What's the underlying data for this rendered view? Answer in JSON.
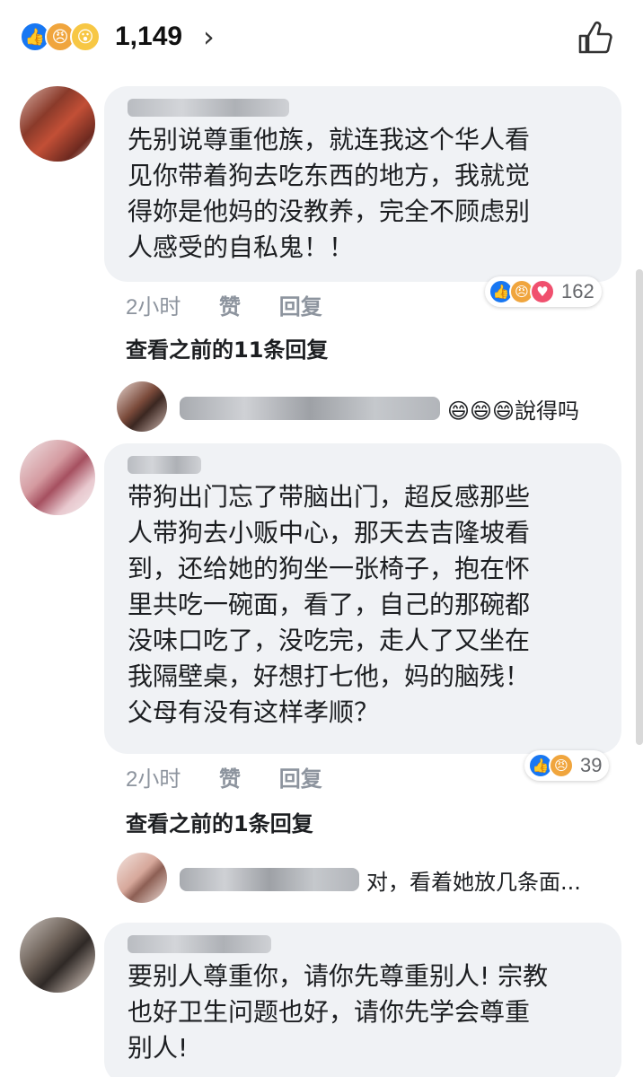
{
  "header": {
    "reaction_icons": [
      "like-icon",
      "angry-icon",
      "wow-icon"
    ],
    "reaction_count": "1,149",
    "chevron": "›"
  },
  "comments": [
    {
      "text": "先别说尊重他族，就连我这个华人看\n见你带着狗去吃东西的地方，我就觉\n得妳是他妈的没教养，完全不顾虑别\n人感受的自私鬼！！",
      "time": "2小时",
      "like_label": "赞",
      "reply_label": "回复",
      "reaction_count": "162",
      "reaction_icons": [
        "like-icon",
        "angry-icon",
        "love-icon"
      ],
      "view_more": "查看之前的11条回复",
      "reply_snippet": "😄😄😄說得吗"
    },
    {
      "text": "带狗出门忘了带脑出门，超反感那些\n人带狗去小贩中心，那天去吉隆坡看\n到，还给她的狗坐一张椅子，抱在怀\n里共吃一碗面，看了，自己的那碗都\n没味口吃了，没吃完，走人了又坐在\n我隔壁桌，好想打七他，妈的脑残！\n父母有没有这样孝顺？",
      "time": "2小时",
      "like_label": "赞",
      "reply_label": "回复",
      "reaction_count": "39",
      "reaction_icons": [
        "like-icon",
        "angry-icon"
      ],
      "view_more": "查看之前的1条回复",
      "reply_snippet": "对，看着她放几条面..."
    },
    {
      "text": "要别人尊重你，请你先尊重别人! 宗教\n也好卫生问题也好，请你先学会尊重\n别人!"
    }
  ]
}
